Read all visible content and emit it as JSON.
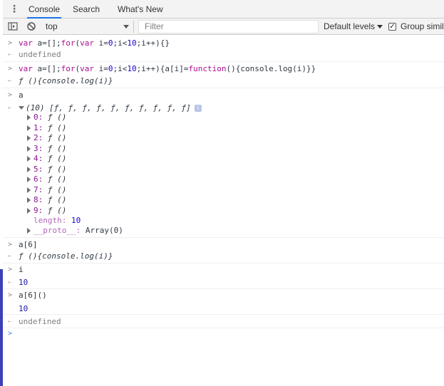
{
  "tabs": [
    {
      "label": "Console"
    },
    {
      "label": "Search"
    },
    {
      "label": "What's New"
    }
  ],
  "toolbar": {
    "context": "top",
    "filter_placeholder": "Filter",
    "levels": "Default levels",
    "group_similar": "Group simil"
  },
  "console": {
    "entries": [
      {
        "type": "input",
        "text_parts": [
          "var",
          " a=[];",
          "for",
          "(",
          "var",
          " i=",
          "0",
          ";i<",
          "10",
          ";i++){}"
        ]
      },
      {
        "type": "output",
        "text": "undefined"
      },
      {
        "type": "input",
        "text_parts": [
          "var",
          " a=[];",
          "for",
          "(",
          "var",
          " i=",
          "0",
          ";i<",
          "10",
          ";i++){a[i]=",
          "function",
          "(){console.log(i)}}"
        ]
      },
      {
        "type": "output",
        "text": "ƒ (){console.log(i)}"
      },
      {
        "type": "input",
        "text": "a"
      },
      {
        "type": "array_header",
        "text": "(10) [ƒ, ƒ, ƒ, ƒ, ƒ, ƒ, ƒ, ƒ, ƒ, ƒ]"
      },
      {
        "type": "array_items",
        "items": [
          {
            "key": "0",
            "value": "ƒ ()"
          },
          {
            "key": "1",
            "value": "ƒ ()"
          },
          {
            "key": "2",
            "value": "ƒ ()"
          },
          {
            "key": "3",
            "value": "ƒ ()"
          },
          {
            "key": "4",
            "value": "ƒ ()"
          },
          {
            "key": "5",
            "value": "ƒ ()"
          },
          {
            "key": "6",
            "value": "ƒ ()"
          },
          {
            "key": "7",
            "value": "ƒ ()"
          },
          {
            "key": "8",
            "value": "ƒ ()"
          },
          {
            "key": "9",
            "value": "ƒ ()"
          }
        ]
      },
      {
        "type": "length",
        "key": "length",
        "value": "10"
      },
      {
        "type": "proto",
        "key": "__proto__",
        "value": "Array(0)"
      },
      {
        "type": "input",
        "text": "a[6]"
      },
      {
        "type": "output",
        "text": "ƒ (){console.log(i)}"
      },
      {
        "type": "input",
        "text": "i"
      },
      {
        "type": "output_num",
        "text": "10"
      },
      {
        "type": "input",
        "text": "a[6]()"
      },
      {
        "type": "log_num",
        "text": "10"
      },
      {
        "type": "output",
        "text": "undefined"
      }
    ]
  }
}
